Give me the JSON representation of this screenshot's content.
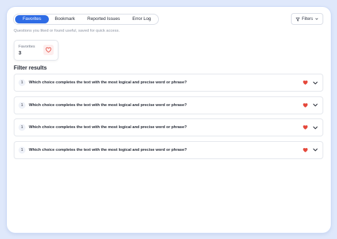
{
  "tabs": [
    {
      "label": "Favorites",
      "active": true
    },
    {
      "label": "Bookmark",
      "active": false
    },
    {
      "label": "Reported Issues",
      "active": false
    },
    {
      "label": "Error Log",
      "active": false
    }
  ],
  "filters_button": {
    "label": "Filters",
    "icon": "filter-icon"
  },
  "subtitle": "Questions you liked or found useful, saved for quick access.",
  "stat": {
    "label": "Favorites",
    "value": "3",
    "icon": "heart-outline-icon"
  },
  "section_title": "Filter results",
  "questions": [
    {
      "number": "1",
      "text": "Which choice completes the text with the most logical and precise word or phrase?"
    },
    {
      "number": "1",
      "text": "Which choice completes the text with the most logical and precise word or phrase?"
    },
    {
      "number": "1",
      "text": "Which choice completes the text with the most logical and precise word or phrase?"
    },
    {
      "number": "1",
      "text": "Which choice completes the text with the most logical and precise word or phrase?"
    }
  ],
  "colors": {
    "accent": "#2f6ce5",
    "heart": "#e5483b",
    "background": "#dfe8fb"
  }
}
